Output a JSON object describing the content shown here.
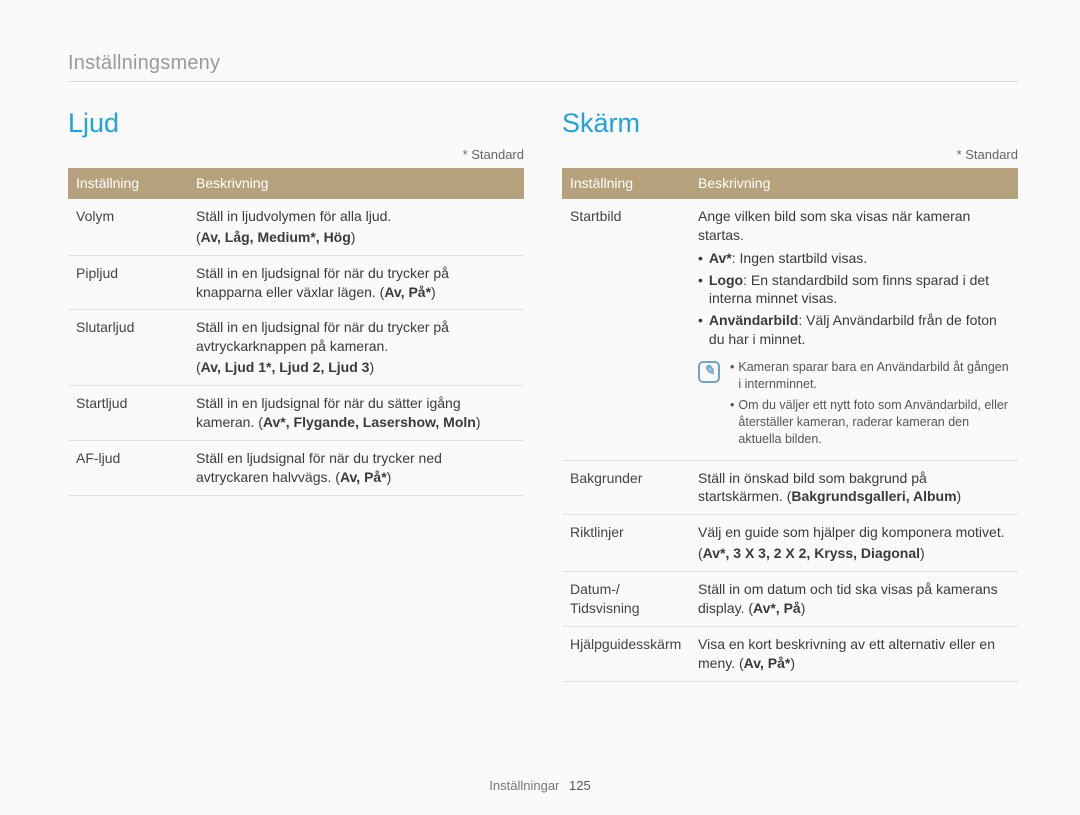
{
  "breadcrumb": "Inställningsmeny",
  "standard_note": "* Standard",
  "footer": {
    "label": "Inställningar",
    "page": "125"
  },
  "left": {
    "title": "Ljud",
    "headers": [
      "Inställning",
      "Beskrivning"
    ],
    "rows": [
      {
        "setting": "Volym",
        "desc": "Ställ in ljudvolymen för alla ljud.",
        "opts_prefix": "(",
        "opts": "Av, Låg, Medium*, Hög",
        "opts_suffix": ")"
      },
      {
        "setting": "Pipljud",
        "desc": "Ställ in en ljudsignal för när du trycker på knapparna eller växlar lägen. (",
        "opts": "Av, På*",
        "opts_suffix": ")"
      },
      {
        "setting": "Slutarljud",
        "desc": "Ställ in en ljudsignal för när du trycker på avtryckarknappen på kameran.",
        "opts_prefix": "(",
        "opts": "Av, Ljud 1*, Ljud 2, Ljud 3",
        "opts_suffix": ")"
      },
      {
        "setting": "Startljud",
        "desc": "Ställ in en ljudsignal för när du sätter igång kameran. (",
        "opts": "Av*, Flygande, Lasershow, Moln",
        "opts_suffix": ")"
      },
      {
        "setting": "AF-ljud",
        "desc": "Ställ en ljudsignal för när du trycker ned avtryckaren halvvägs. (",
        "opts": "Av, På*",
        "opts_suffix": ")"
      }
    ]
  },
  "right": {
    "title": "Skärm",
    "headers": [
      "Inställning",
      "Beskrivning"
    ],
    "startbild": {
      "setting": "Startbild",
      "intro": "Ange vilken bild som ska visas när kameran startas.",
      "items": [
        {
          "label": "Av*",
          "text": ": Ingen startbild visas."
        },
        {
          "label": "Logo",
          "text": ": En standardbild som finns sparad i det interna minnet visas."
        },
        {
          "label": "Användarbild",
          "text": ": Välj Användarbild från de foton du har i minnet."
        }
      ],
      "notes": [
        "Kameran sparar bara en Användarbild åt gången i internminnet.",
        "Om du väljer ett nytt foto som Användarbild, eller återställer kameran, raderar kameran den aktuella bilden."
      ]
    },
    "bakgrunder": {
      "setting": "Bakgrunder",
      "desc": "Ställ in önskad bild som bakgrund på startskärmen. (",
      "opts": "Bakgrundsgalleri, Album",
      "opts_suffix": ")"
    },
    "riktlinjer": {
      "setting": "Riktlinjer",
      "desc": "Välj en guide som hjälper dig komponera motivet.",
      "opts_prefix": "(",
      "opts": "Av*, 3 X 3, 2 X 2, Kryss, Diagonal",
      "opts_suffix": ")"
    },
    "datum": {
      "setting": "Datum-/ Tidsvisning",
      "desc": "Ställ in om datum och tid ska visas på kamerans display. (",
      "opts": "Av*, På",
      "opts_suffix": ")"
    },
    "hjalp": {
      "setting": "Hjälpguidesskärm",
      "desc": "Visa en kort beskrivning av ett alternativ eller en meny. (",
      "opts": "Av, På*",
      "opts_suffix": ")"
    }
  }
}
